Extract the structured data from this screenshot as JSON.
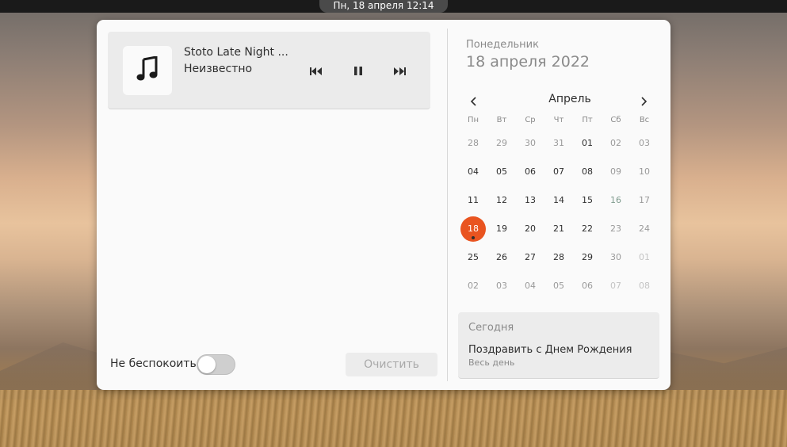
{
  "topbar": {
    "clock": "Пн, 18 апреля  12:14"
  },
  "media": {
    "title": "Stoto Late Night ...",
    "artist": "Неизвестно",
    "album_icon": "music-note-icon",
    "controls": [
      "previous-track-icon",
      "pause-icon",
      "next-track-icon"
    ]
  },
  "notifications": {
    "dnd_label": "Не беспокоить",
    "dnd_enabled": false,
    "clear_label": "Очистить"
  },
  "calendar": {
    "day_name": "Понедельник",
    "full_date": "18 апреля 2022",
    "month": "Апрель",
    "weekdays": [
      "Пн",
      "Вт",
      "Ср",
      "Чт",
      "Пт",
      "Сб",
      "Вс"
    ],
    "weeks": [
      [
        "28",
        "29",
        "30",
        "31",
        "01",
        "02",
        "03"
      ],
      [
        "04",
        "05",
        "06",
        "07",
        "08",
        "09",
        "10"
      ],
      [
        "11",
        "12",
        "13",
        "14",
        "15",
        "16",
        "17"
      ],
      [
        "18",
        "19",
        "20",
        "21",
        "22",
        "23",
        "24"
      ],
      [
        "25",
        "26",
        "27",
        "28",
        "29",
        "30",
        "01"
      ],
      [
        "02",
        "03",
        "04",
        "05",
        "06",
        "07",
        "08"
      ]
    ],
    "selected": "18",
    "accent_color": "#e95420"
  },
  "events": {
    "header": "Сегодня",
    "items": [
      {
        "title": "Поздравить с Днем Рождения",
        "time": "Весь день"
      }
    ]
  }
}
